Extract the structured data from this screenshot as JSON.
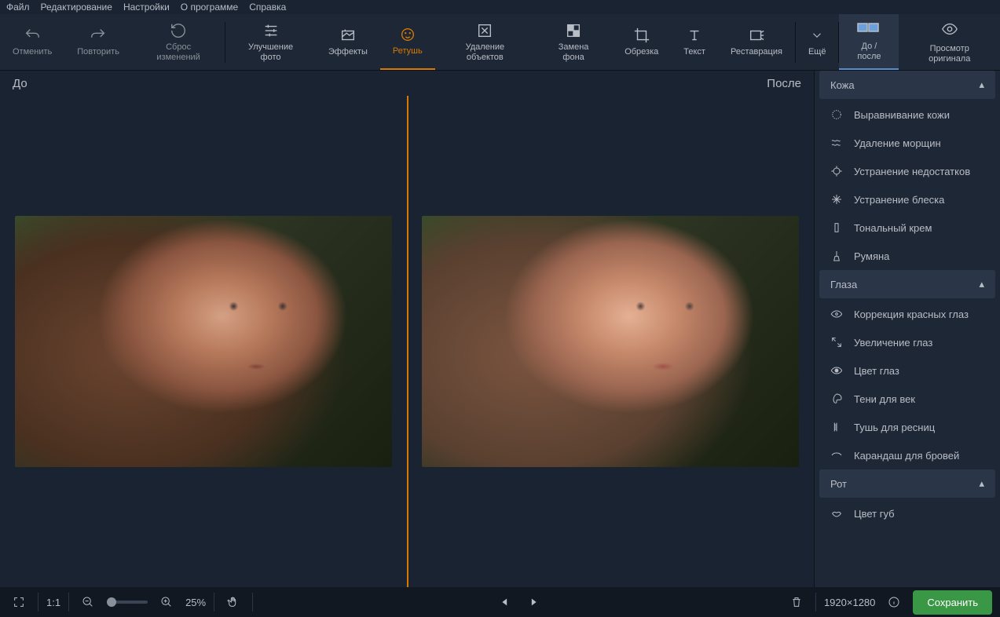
{
  "menu": {
    "file": "Файл",
    "edit": "Редактирование",
    "settings": "Настройки",
    "about": "О программе",
    "help": "Справка"
  },
  "tools": {
    "undo": "Отменить",
    "redo": "Повторить",
    "reset": "Сброс изменений",
    "enhance": "Улучшение фото",
    "effects": "Эффекты",
    "retouch": "Ретушь",
    "remove": "Удаление объектов",
    "bg": "Замена фона",
    "crop": "Обрезка",
    "text": "Текст",
    "restore": "Реставрация",
    "more": "Ещё"
  },
  "view": {
    "before_after": "До / после",
    "original": "Просмотр оригинала"
  },
  "canvas": {
    "before": "До",
    "after": "После"
  },
  "sections": {
    "skin": "Кожа",
    "eyes": "Глаза",
    "mouth": "Рот"
  },
  "items": {
    "skin_smooth": "Выравнивание кожи",
    "wrinkle": "Удаление морщин",
    "blemish": "Устранение недостатков",
    "shine": "Устранение блеска",
    "foundation": "Тональный крем",
    "blush": "Румяна",
    "redeye": "Коррекция красных глаз",
    "enlarge": "Увеличение глаз",
    "eyecolor": "Цвет глаз",
    "eyeshadow": "Тени для век",
    "mascara": "Тушь для ресниц",
    "brow": "Карандаш для бровей",
    "lipcolor": "Цвет губ"
  },
  "footer": {
    "fit": "1:1",
    "zoom": "25%",
    "dimensions": "1920×1280",
    "save": "Сохранить"
  }
}
